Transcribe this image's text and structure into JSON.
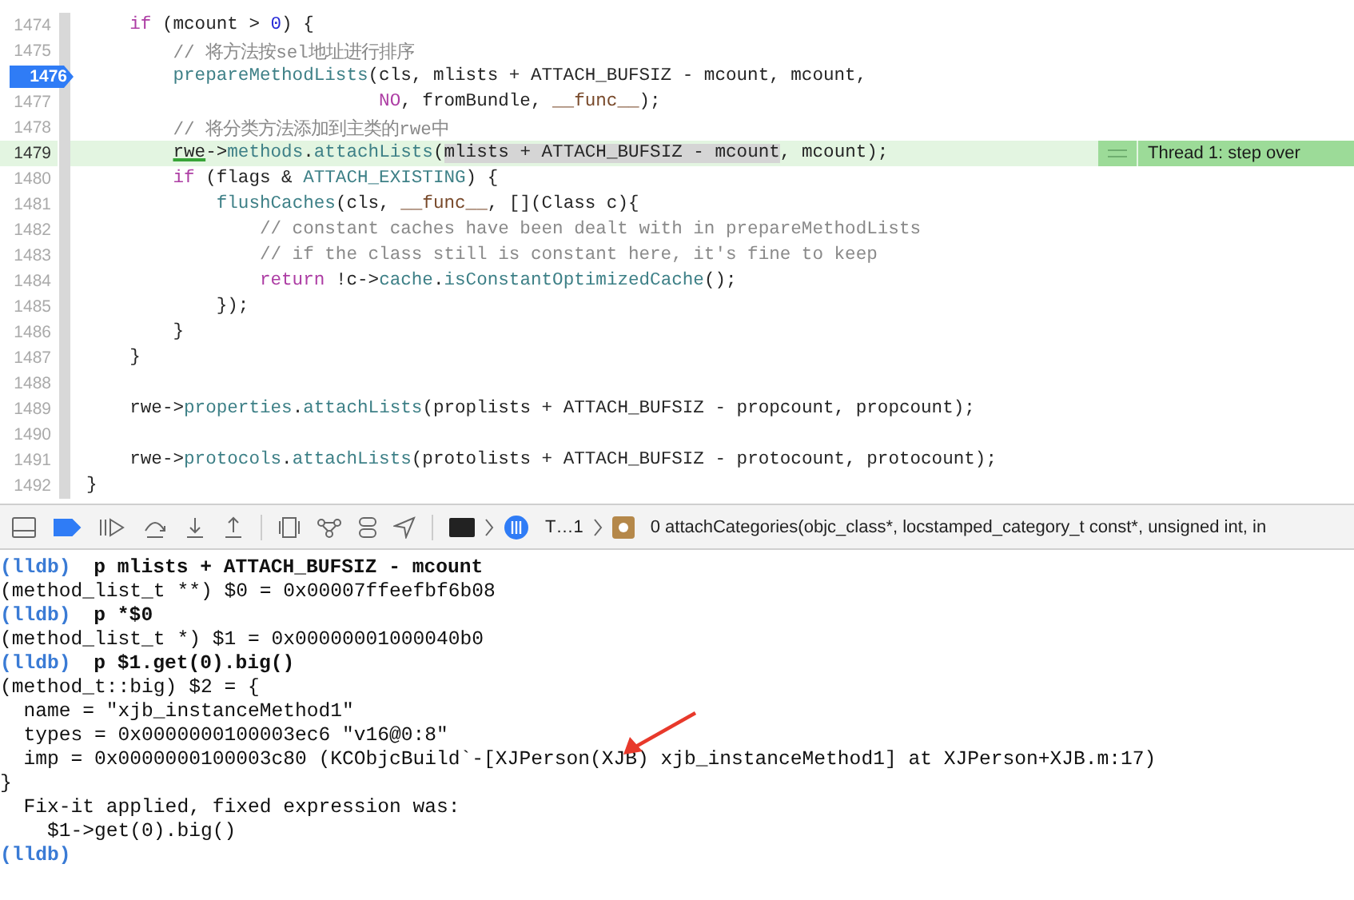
{
  "editor": {
    "lines": [
      {
        "number": "1474",
        "breakpoint": false,
        "current": false,
        "tokens": [
          {
            "kind": "keyword",
            "text": "    if"
          },
          {
            "kind": "plain",
            "text": " (mcount > "
          },
          {
            "kind": "number",
            "text": "0"
          },
          {
            "kind": "plain",
            "text": ") {"
          }
        ]
      },
      {
        "number": "1475",
        "breakpoint": false,
        "current": false,
        "tokens": [
          {
            "kind": "comment",
            "text": "        // 将方法按sel地址进行排序"
          }
        ]
      },
      {
        "number": "1476",
        "breakpoint": true,
        "current": false,
        "tokens": [
          {
            "kind": "function",
            "text": "        prepareMethodLists"
          },
          {
            "kind": "plain",
            "text": "(cls, mlists + ATTACH_BUFSIZ - mcount, mcount,"
          }
        ]
      },
      {
        "number": "1477",
        "breakpoint": false,
        "current": false,
        "tokens": [
          {
            "kind": "keyword",
            "text": "                           NO"
          },
          {
            "kind": "plain",
            "text": ", fromBundle, "
          },
          {
            "kind": "macro",
            "text": "__func__"
          },
          {
            "kind": "plain",
            "text": ");"
          }
        ]
      },
      {
        "number": "1478",
        "breakpoint": false,
        "current": false,
        "tokens": [
          {
            "kind": "comment",
            "text": "        // 将分类方法添加到主类的rwe中"
          }
        ]
      },
      {
        "number": "1479",
        "breakpoint": false,
        "current": true,
        "badge": "Thread 1: step over",
        "tokens": [
          {
            "kind": "underlined",
            "text": "        rwe"
          },
          {
            "kind": "plain",
            "text": "->"
          },
          {
            "kind": "function",
            "text": "methods"
          },
          {
            "kind": "plain",
            "text": "."
          },
          {
            "kind": "function",
            "text": "attachLists"
          },
          {
            "kind": "plain",
            "text": "("
          },
          {
            "kind": "selected",
            "text": "mlists + ATTACH_BUFSIZ - mcount"
          },
          {
            "kind": "plain",
            "text": ", mcount);"
          }
        ]
      },
      {
        "number": "1480",
        "breakpoint": false,
        "current": false,
        "tokens": [
          {
            "kind": "keyword",
            "text": "        if"
          },
          {
            "kind": "plain",
            "text": " (flags & "
          },
          {
            "kind": "function",
            "text": "ATTACH_EXISTING"
          },
          {
            "kind": "plain",
            "text": ") {"
          }
        ]
      },
      {
        "number": "1481",
        "breakpoint": false,
        "current": false,
        "tokens": [
          {
            "kind": "function",
            "text": "            flushCaches"
          },
          {
            "kind": "plain",
            "text": "(cls, "
          },
          {
            "kind": "macro",
            "text": "__func__"
          },
          {
            "kind": "plain",
            "text": ", [](Class c){"
          }
        ]
      },
      {
        "number": "1482",
        "breakpoint": false,
        "current": false,
        "tokens": [
          {
            "kind": "comment",
            "text": "                // constant caches have been dealt with in prepareMethodLists"
          }
        ]
      },
      {
        "number": "1483",
        "breakpoint": false,
        "current": false,
        "tokens": [
          {
            "kind": "comment",
            "text": "                // if the class still is constant here, it's fine to keep"
          }
        ]
      },
      {
        "number": "1484",
        "breakpoint": false,
        "current": false,
        "tokens": [
          {
            "kind": "keyword",
            "text": "                return"
          },
          {
            "kind": "plain",
            "text": " !c->"
          },
          {
            "kind": "function",
            "text": "cache"
          },
          {
            "kind": "plain",
            "text": "."
          },
          {
            "kind": "function",
            "text": "isConstantOptimizedCache"
          },
          {
            "kind": "plain",
            "text": "();"
          }
        ]
      },
      {
        "number": "1485",
        "breakpoint": false,
        "current": false,
        "tokens": [
          {
            "kind": "plain",
            "text": "            });"
          }
        ]
      },
      {
        "number": "1486",
        "breakpoint": false,
        "current": false,
        "tokens": [
          {
            "kind": "plain",
            "text": "        }"
          }
        ]
      },
      {
        "number": "1487",
        "breakpoint": false,
        "current": false,
        "tokens": [
          {
            "kind": "plain",
            "text": "    }"
          }
        ]
      },
      {
        "number": "1488",
        "breakpoint": false,
        "current": false
      },
      {
        "number": "1489",
        "breakpoint": false,
        "current": false,
        "tokens": [
          {
            "kind": "plain",
            "text": "    rwe->"
          },
          {
            "kind": "function",
            "text": "properties"
          },
          {
            "kind": "plain",
            "text": "."
          },
          {
            "kind": "function",
            "text": "attachLists"
          },
          {
            "kind": "plain",
            "text": "(proplists + ATTACH_BUFSIZ - propcount, propcount);"
          }
        ]
      },
      {
        "number": "1490",
        "breakpoint": false,
        "current": false
      },
      {
        "number": "1491",
        "breakpoint": false,
        "current": false,
        "tokens": [
          {
            "kind": "plain",
            "text": "    rwe->"
          },
          {
            "kind": "function",
            "text": "protocols"
          },
          {
            "kind": "plain",
            "text": "."
          },
          {
            "kind": "function",
            "text": "attachLists"
          },
          {
            "kind": "plain",
            "text": "(protolists + ATTACH_BUFSIZ - protocount, protocount);"
          }
        ]
      },
      {
        "number": "1492",
        "breakpoint": false,
        "current": false,
        "tokens": [
          {
            "kind": "plain",
            "text": "}"
          }
        ]
      }
    ]
  },
  "debug_bar": {
    "breakpoints_active": true,
    "thread": "T…1",
    "frame": "0 attachCategories(objc_class*, locstamped_category_t const*, unsigned int, in"
  },
  "console": {
    "lines": [
      {
        "kind": "command",
        "prompt": "(lldb)",
        "text": "p mlists + ATTACH_BUFSIZ - mcount"
      },
      {
        "kind": "output",
        "text": "(method_list_t **) $0 = 0x00007ffeefbf6b08"
      },
      {
        "kind": "command",
        "prompt": "(lldb)",
        "text": "p *$0"
      },
      {
        "kind": "output",
        "text": "(method_list_t *) $1 = 0x00000001000040b0"
      },
      {
        "kind": "command",
        "prompt": "(lldb)",
        "text": "p $1.get(0).big()"
      },
      {
        "kind": "output",
        "text": "(method_t::big) $2 = {"
      },
      {
        "kind": "output",
        "text": "  name = \"xjb_instanceMethod1\""
      },
      {
        "kind": "output",
        "text": "  types = 0x0000000100003ec6 \"v16@0:8\""
      },
      {
        "kind": "output",
        "text": "  imp = 0x0000000100003c80 (KCObjcBuild`-[XJPerson(XJB) xjb_instanceMethod1] at XJPerson+XJB.m:17)"
      },
      {
        "kind": "output",
        "text": "}"
      },
      {
        "kind": "output",
        "text": "  Fix-it applied, fixed expression was:"
      },
      {
        "kind": "output",
        "text": "    $1->get(0).big()"
      },
      {
        "kind": "command",
        "prompt": "(lldb)"
      }
    ]
  }
}
